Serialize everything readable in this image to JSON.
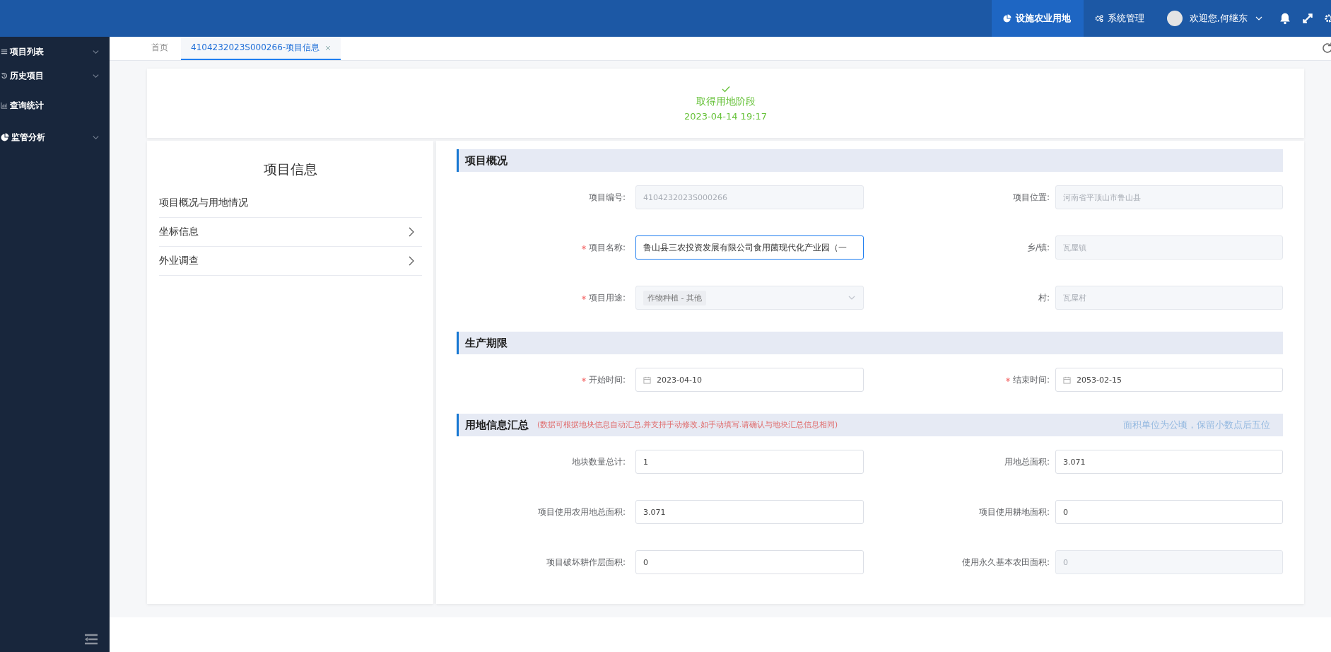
{
  "topbar": {
    "nav": [
      {
        "label": "设施农业用地",
        "selected": true
      },
      {
        "label": "系统管理",
        "selected": false
      }
    ],
    "user": {
      "greeting": "欢迎您,何继东"
    }
  },
  "sidebar": {
    "items": [
      {
        "label": "项目列表",
        "has_submenu": true
      },
      {
        "label": "历史项目",
        "has_submenu": true
      },
      {
        "label": "查询统计",
        "has_submenu": false
      },
      {
        "label": "监管分析",
        "has_submenu": true
      }
    ]
  },
  "tabs": [
    {
      "label": "首页",
      "selected": false,
      "closable": false
    },
    {
      "label": "4104232023S000266-项目信息",
      "selected": true,
      "closable": true
    }
  ],
  "stage": {
    "title": "取得用地阶段",
    "time": "2023-04-14 19:17"
  },
  "left_panel": {
    "title": "项目信息",
    "items": [
      {
        "label": "项目概况与用地情况",
        "has_arrow": false
      },
      {
        "label": "坐标信息",
        "has_arrow": true
      },
      {
        "label": "外业调查",
        "has_arrow": true
      }
    ]
  },
  "sections": [
    {
      "title": "项目概况",
      "fields": [
        {
          "label": "项目编号:",
          "value": "4104232023S000266",
          "kind": "text",
          "required": false,
          "disabled": true,
          "focused": false
        },
        {
          "label": "项目位置:",
          "value": "河南省平顶山市鲁山县",
          "kind": "text",
          "required": false,
          "disabled": true,
          "focused": false
        },
        {
          "label": "项目名称:",
          "value": "鲁山县三农投资发展有限公司食用菌现代化产业园（一",
          "kind": "text",
          "required": true,
          "disabled": false,
          "focused": true
        },
        {
          "label": "乡/镇:",
          "value": "瓦屋镇",
          "kind": "text",
          "required": false,
          "disabled": true,
          "focused": false
        },
        {
          "label": "项目用途:",
          "value": "作物种植 - 其他",
          "kind": "select",
          "required": true,
          "disabled": true,
          "focused": false
        },
        {
          "label": "村:",
          "value": "瓦屋村",
          "kind": "text",
          "required": false,
          "disabled": true,
          "focused": false
        }
      ]
    },
    {
      "title": "生产期限",
      "fields": [
        {
          "label": "开始时间:",
          "value": "2023-04-10",
          "kind": "date",
          "required": true,
          "disabled": false,
          "focused": false
        },
        {
          "label": "结束时间:",
          "value": "2053-02-15",
          "kind": "date",
          "required": true,
          "disabled": false,
          "focused": false
        }
      ]
    },
    {
      "title": "用地信息汇总",
      "note": "(数据可根据地块信息自动汇总,并支持手动修改.如手动填写.请确认与地块汇总信息相同)",
      "hint": "面积单位为公顷，保留小数点后五位",
      "fields": [
        {
          "label": "地块数量总计:",
          "value": "1",
          "kind": "text",
          "required": false,
          "disabled": false,
          "focused": false
        },
        {
          "label": "用地总面积:",
          "value": "3.071",
          "kind": "text",
          "required": false,
          "disabled": false,
          "focused": false
        },
        {
          "label": "项目使用农用地总面积:",
          "value": "3.071",
          "kind": "text",
          "required": false,
          "disabled": false,
          "focused": false
        },
        {
          "label": "项目使用耕地面积:",
          "value": "0",
          "kind": "text",
          "required": false,
          "disabled": false,
          "focused": false
        },
        {
          "label": "项目破坏耕作层面积:",
          "value": "0",
          "kind": "text",
          "required": false,
          "disabled": false,
          "focused": false
        },
        {
          "label": "使用永久基本农田面积:",
          "value": "0",
          "kind": "text",
          "required": false,
          "disabled": true,
          "focused": false
        }
      ]
    }
  ]
}
